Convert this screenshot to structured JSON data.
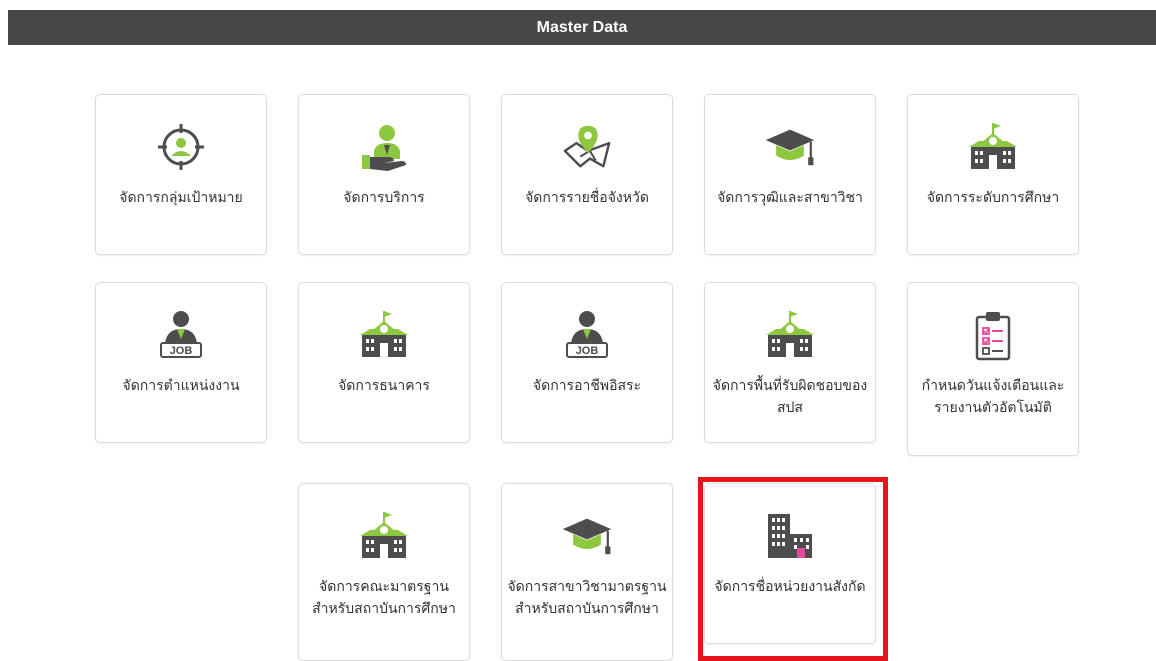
{
  "header": {
    "title": "Master Data"
  },
  "colors": {
    "accent_green": "#8dc63f",
    "icon_dark": "#4d4d4d",
    "highlight": "#e8141b",
    "accent_pink": "#e44b9c"
  },
  "cards": [
    {
      "label": "จัดการกลุ่มเป้าหมาย",
      "icon": "target-user-icon"
    },
    {
      "label": "จัดการบริการ",
      "icon": "service-hand-icon"
    },
    {
      "label": "จัดการรายชื่อจังหวัด",
      "icon": "map-pin-icon"
    },
    {
      "label": "จัดการวุฒิและสาขาวิชา",
      "icon": "graduation-cap-icon"
    },
    {
      "label": "จัดการระดับการศึกษา",
      "icon": "school-building-icon"
    },
    {
      "label": "จัดการตำแหน่งงาน",
      "icon": "job-person-icon"
    },
    {
      "label": "จัดการธนาคาร",
      "icon": "bank-building-icon"
    },
    {
      "label": "จัดการอาชีพอิสระ",
      "icon": "job-person-icon"
    },
    {
      "label": "จัดการพื้นที่รับผิดชอบของ สปส",
      "icon": "school-building-icon"
    },
    {
      "label": "กำหนดวันแจ้งเตือนและรายงานตัวอัตโนมัติ",
      "icon": "checklist-clipboard-icon"
    },
    {
      "label": "จัดการคณะมาตรฐานสำหรับสถาบันการศึกษา",
      "icon": "school-building-icon"
    },
    {
      "label": "จัดการสาขาวิชามาตรฐานสำหรับสถาบันการศึกษา",
      "icon": "graduation-cap-icon"
    },
    {
      "label": "จัดการชื่อหน่วยงานสังกัด",
      "icon": "office-buildings-icon"
    }
  ]
}
